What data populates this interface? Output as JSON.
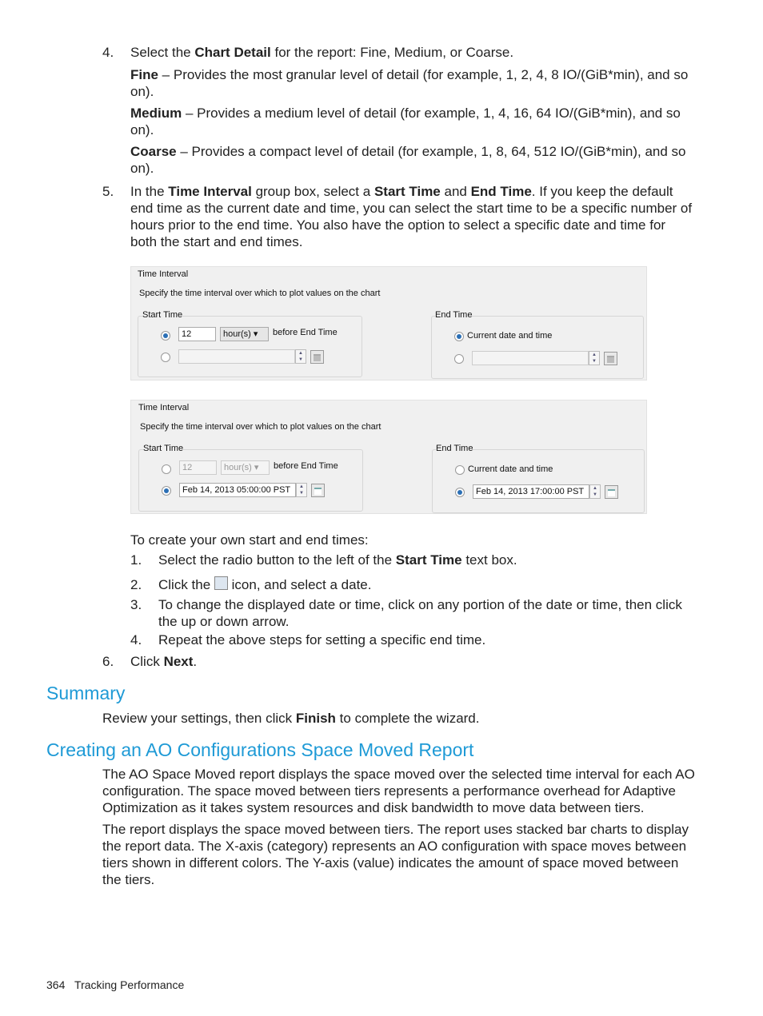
{
  "steps_top": [
    {
      "num": "4.",
      "pre": "Select the ",
      "bold": "Chart Detail",
      "post": " for the report: Fine, Medium, or Coarse."
    },
    {
      "bold": "Fine",
      "post": " – Provides the most granular level of detail (for example, 1, 2, 4, 8 IO/(GiB*min), and so on)."
    },
    {
      "bold": "Medium",
      "post": " – Provides a medium level of detail (for example, 1, 4, 16, 64 IO/(GiB*min), and so on)."
    },
    {
      "bold": "Coarse",
      "post": " – Provides a compact level of detail (for example, 1, 8, 64, 512 IO/(GiB*min), and so on)."
    }
  ],
  "step5": {
    "num": "5.",
    "a": "In the ",
    "b1": "Time Interval",
    "c": " group box, select a ",
    "b2": "Start Time",
    "d": " and ",
    "b3": "End Time",
    "e": ". If you keep the default end time as the current date and time, you can select the start time to be a specific number of hours prior to the end time. You also have the option to select a specific date and time for both the start and end times."
  },
  "dialogs": [
    {
      "title": "Time Interval",
      "desc": "Specify the time interval over which to plot values on the chart",
      "start_label": "Start Time",
      "end_label": "End Time",
      "hours_value": "12",
      "unit": "hour(s)",
      "before": "before End Time",
      "current": "Current date and time",
      "start_date": "",
      "end_date": "",
      "selected_start": "relative",
      "selected_end": "current"
    },
    {
      "title": "Time Interval",
      "desc": "Specify the time interval over which to plot values on the chart",
      "start_label": "Start Time",
      "end_label": "End Time",
      "hours_value": "12",
      "unit": "hour(s)",
      "before": "before End Time",
      "current": "Current date and time",
      "start_date": "Feb 14, 2013 05:00:00 PST",
      "end_date": "Feb 14, 2013 17:00:00 PST",
      "selected_start": "specific",
      "selected_end": "specific"
    }
  ],
  "create": {
    "intro": "To create your own start and end times:",
    "s1": {
      "num": "1.",
      "a": "Select the radio button to the left of the ",
      "b": "Start Time",
      "c": " text box."
    },
    "s2": {
      "num": "2.",
      "a": "Click the ",
      "c": " icon, and select a date."
    },
    "s3": {
      "num": "3.",
      "a": "To change the displayed date or time, click on any portion of the date or time, then click the up or down arrow."
    },
    "s4": {
      "num": "4.",
      "a": "Repeat the above steps for setting a specific end time."
    }
  },
  "step6": {
    "num": "6.",
    "a": "Click ",
    "b": "Next",
    "c": "."
  },
  "summary": {
    "heading": "Summary",
    "a": "Review your settings, then click ",
    "b": "Finish",
    "c": " to complete the wizard."
  },
  "ao": {
    "heading": "Creating an AO Configurations Space Moved Report",
    "p1": "The AO Space Moved report displays the space moved over the selected time interval for each AO configuration. The space moved between tiers represents a performance overhead for Adaptive Optimization as it takes system resources and disk bandwidth to move data between tiers.",
    "p2": "The report displays the space moved between tiers. The report uses stacked bar charts to display the report data. The X-axis (category) represents an AO configuration with space moves between tiers shown in different colors. The Y-axis (value) indicates the amount of space moved between the tiers."
  },
  "footer": {
    "page": "364",
    "section": "Tracking Performance"
  },
  "colors": {
    "heading": "#1e9ad6",
    "radio_selected": "#2b6fb5"
  }
}
